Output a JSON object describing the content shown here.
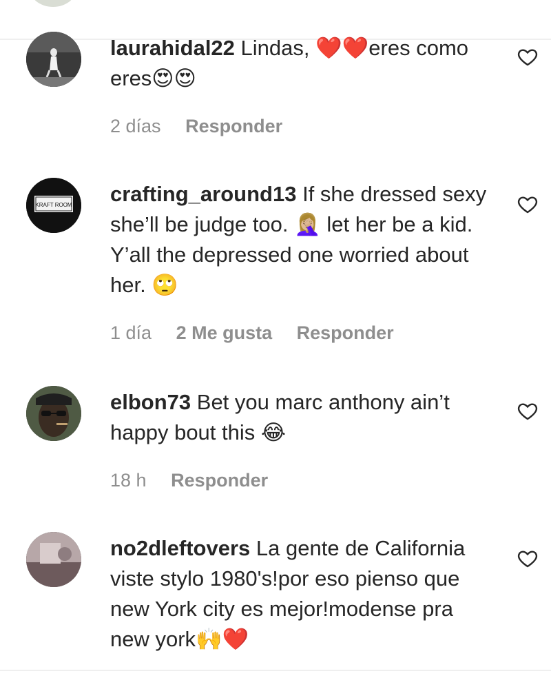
{
  "comments": [
    {
      "username": "laurahidal22",
      "text": " Lindas, ❤️❤️eres como eres😍😍",
      "time": "2 días",
      "likes": "",
      "reply": "Responder"
    },
    {
      "username": "crafting_around13",
      "text": " If she dressed sexy she’ll be judge too. 🤦🏼‍♀️ let her be a kid. Y’all the depressed one worried about her. 🙄",
      "time": "1 día",
      "likes": "2 Me gusta",
      "reply": "Responder"
    },
    {
      "username": "elbon73",
      "text": " Bet you marc anthony ain’t happy bout this 😂",
      "time": "18 h",
      "likes": "",
      "reply": "Responder"
    },
    {
      "username": "no2dleftovers",
      "text": " La gente de California viste stylo 1980's!por eso pienso que new York city es mejor!modense pra new york🙌❤️",
      "time": "",
      "likes": "",
      "reply": ""
    }
  ],
  "avatars": {
    "c2_sign_text": "KRAFT ROOM"
  },
  "colors": {
    "text": "#262626",
    "meta": "#8e8e8e",
    "divider": "#efefef"
  }
}
